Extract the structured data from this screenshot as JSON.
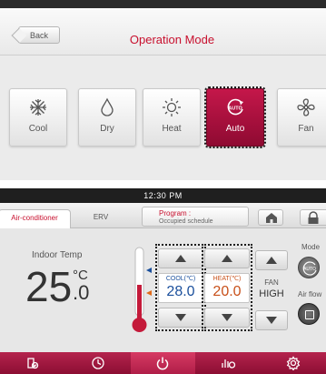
{
  "top": {
    "back_label": "Back",
    "title": "Operation Mode",
    "modes": [
      {
        "label": "Cool",
        "icon": "snowflake-icon",
        "selected": false
      },
      {
        "label": "Dry",
        "icon": "droplet-icon",
        "selected": false
      },
      {
        "label": "Heat",
        "icon": "sun-icon",
        "selected": false
      },
      {
        "label": "Auto",
        "icon": "auto-icon",
        "selected": true
      },
      {
        "label": "Fan",
        "icon": "fan-icon",
        "selected": false
      }
    ]
  },
  "bottom": {
    "time": "12:30 PM",
    "tabs": [
      "Air-conditioner",
      "ERV"
    ],
    "program_label": "Program :",
    "program_value": "Occupied schedule",
    "indoor_label": "Indoor Temp",
    "indoor_temp_int": "25",
    "indoor_temp_dec": ".0",
    "indoor_unit": "°C",
    "cool_label": "COOL(℃)",
    "cool_value": "28.0",
    "heat_label": "HEAT(℃)",
    "heat_value": "20.0",
    "fan_label": "FAN",
    "fan_value": "HIGH",
    "mode_label": "Mode",
    "airflow_label": "Air flow",
    "nav_icons": [
      "reservation-icon",
      "clock-icon",
      "power-icon",
      "energy-icon",
      "settings-icon"
    ]
  },
  "colors": {
    "accent": "#c8102e",
    "selected_tile": "#a80f3c",
    "nav_bar": "#a51a44",
    "cool": "#1a4f9c",
    "heat": "#c8501a"
  }
}
